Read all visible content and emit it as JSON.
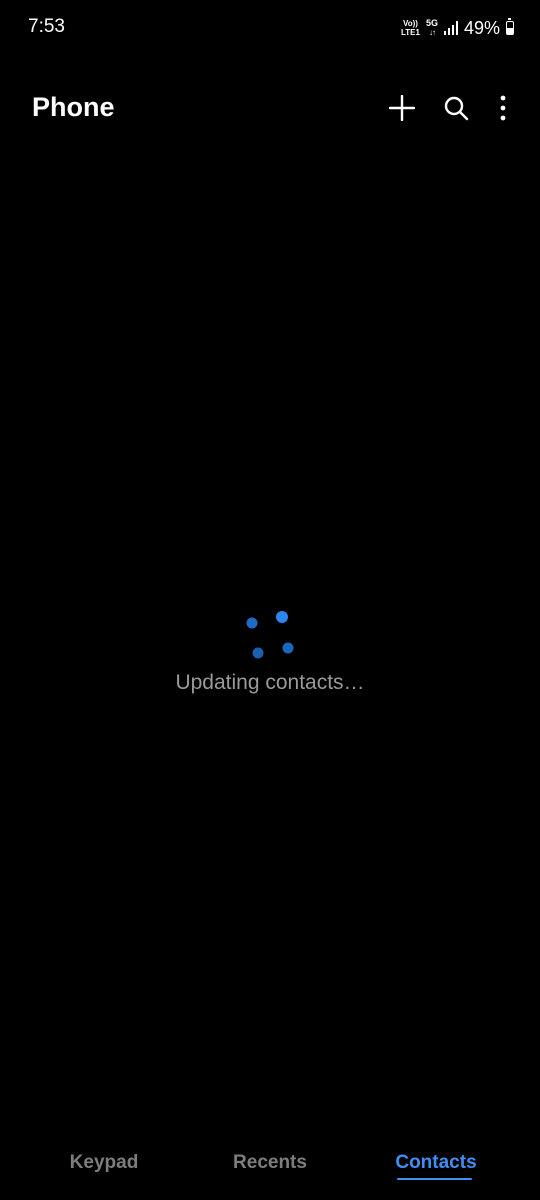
{
  "status_bar": {
    "time": "7:53",
    "volte_top": "Vo))",
    "volte_bottom": "LTE1",
    "network": "5G",
    "network_arrows": "↓↑",
    "battery_percent": "49%",
    "battery_level": 0.49
  },
  "app_bar": {
    "title": "Phone",
    "icons": [
      "plus-icon",
      "search-icon",
      "more-vert-icon"
    ]
  },
  "loading": {
    "message": "Updating contacts…",
    "accent": "#1f7ae0"
  },
  "bottom_nav": {
    "tabs": [
      {
        "label": "Keypad",
        "active": false
      },
      {
        "label": "Recents",
        "active": false
      },
      {
        "label": "Contacts",
        "active": true
      }
    ],
    "active_color": "#3e8ef3",
    "inactive_color": "#7d7d7d"
  }
}
